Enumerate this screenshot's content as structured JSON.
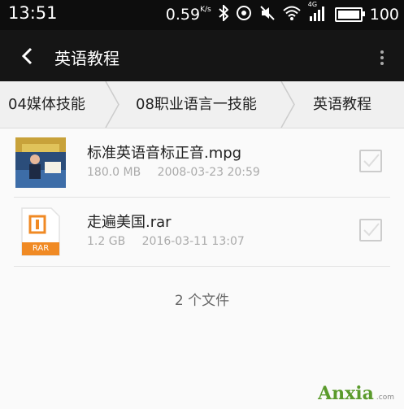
{
  "status_bar": {
    "time": "13:51",
    "speed": "0.59",
    "speed_unit": "K/s",
    "network": "4G",
    "battery": "100"
  },
  "header": {
    "title": "英语教程",
    "back_icon": "chevron-left-icon",
    "menu_icon": "more-vertical-icon"
  },
  "breadcrumb": [
    "04媒体技能",
    "08职业语言一技能",
    "英语教程"
  ],
  "files": [
    {
      "name": "标准英语音标正音.mpg",
      "size": "180.0 MB",
      "date": "2008-03-23 20:59",
      "type": "video"
    },
    {
      "name": "走遍美国.rar",
      "size": "1.2 GB",
      "date": "2016-03-11 13:07",
      "type": "rar",
      "badge": "RAR"
    }
  ],
  "file_count": "2 个文件",
  "watermark": {
    "brand": "Anxia",
    "sub": ".com"
  },
  "colors": {
    "accent_orange": "#f08a24",
    "watermark_green": "#5a9a2b"
  }
}
